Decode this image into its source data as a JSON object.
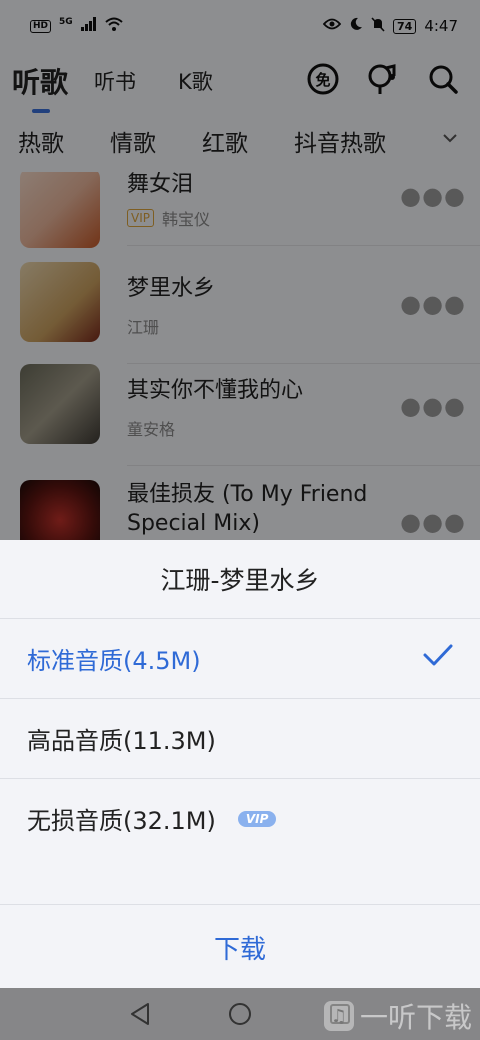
{
  "status_bar": {
    "hd_badge": "HD",
    "network": "5G",
    "battery": "74",
    "time": "4:47"
  },
  "top_nav": {
    "tabs": [
      "听歌",
      "听书",
      "K歌"
    ],
    "icons": [
      "free-icon",
      "karaoke-mic-icon",
      "search-icon"
    ]
  },
  "categories": [
    "热歌",
    "情歌",
    "红歌",
    "抖音热歌"
  ],
  "songs": [
    {
      "title": "舞女泪",
      "artist": "韩宝仪",
      "vip": "VIP"
    },
    {
      "title": "梦里水乡",
      "artist": "江珊"
    },
    {
      "title": "其实你不懂我的心",
      "artist": "童安格"
    },
    {
      "title": "最佳损友 (To My Friend Special Mix)"
    }
  ],
  "sheet": {
    "title": "江珊-梦里水乡",
    "options": [
      {
        "label": "标准音质(4.5M)",
        "selected": true
      },
      {
        "label": "高品音质(11.3M)"
      },
      {
        "label": "无损音质(32.1M)",
        "badge": "VIP"
      }
    ],
    "download_label": "下载"
  },
  "watermark": "一听下载",
  "colors": {
    "accent": "#2f6ad6",
    "vip_gold": "#d9a23c",
    "vip_badge": "#8ab1ee"
  }
}
